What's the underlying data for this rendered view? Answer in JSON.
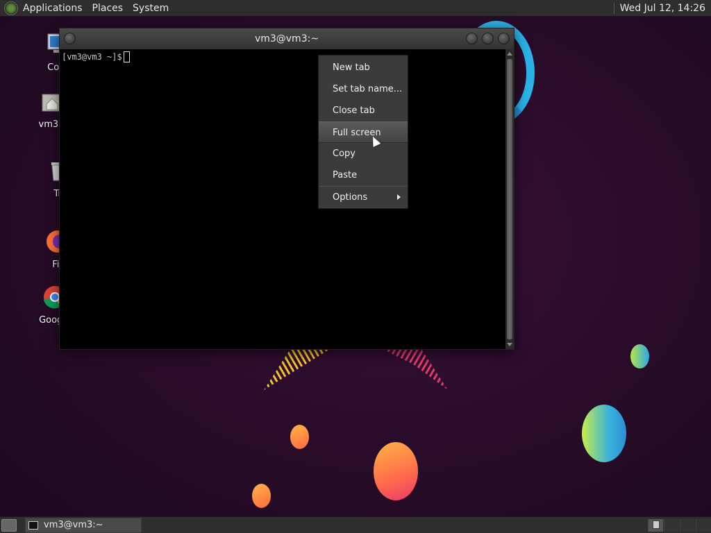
{
  "top_panel": {
    "menus": [
      "Applications",
      "Places",
      "System"
    ],
    "clock": "Wed Jul 12, 14:26"
  },
  "desktop_icons": [
    {
      "label": "Com",
      "icon": "computer-icon"
    },
    {
      "label": "vm3's",
      "icon": "home-folder-icon"
    },
    {
      "label": "Tr",
      "icon": "trash-icon"
    },
    {
      "label": "Fir",
      "icon": "firefox-icon"
    },
    {
      "label": "Google",
      "icon": "chrome-icon"
    }
  ],
  "window": {
    "title": "vm3@vm3:~",
    "prompt": "[vm3@vm3 ~]$"
  },
  "context_menu": {
    "items": [
      "New tab",
      "Set tab name...",
      "Close tab",
      "Full screen",
      "Copy",
      "Paste",
      "Options"
    ],
    "hovered": "Full screen"
  },
  "taskbar": {
    "task_label": "vm3@vm3:~"
  },
  "colors": {
    "panel": "#2e2e2e",
    "terminal_bg": "#000000",
    "wallpaper": "#2a0c2a"
  }
}
